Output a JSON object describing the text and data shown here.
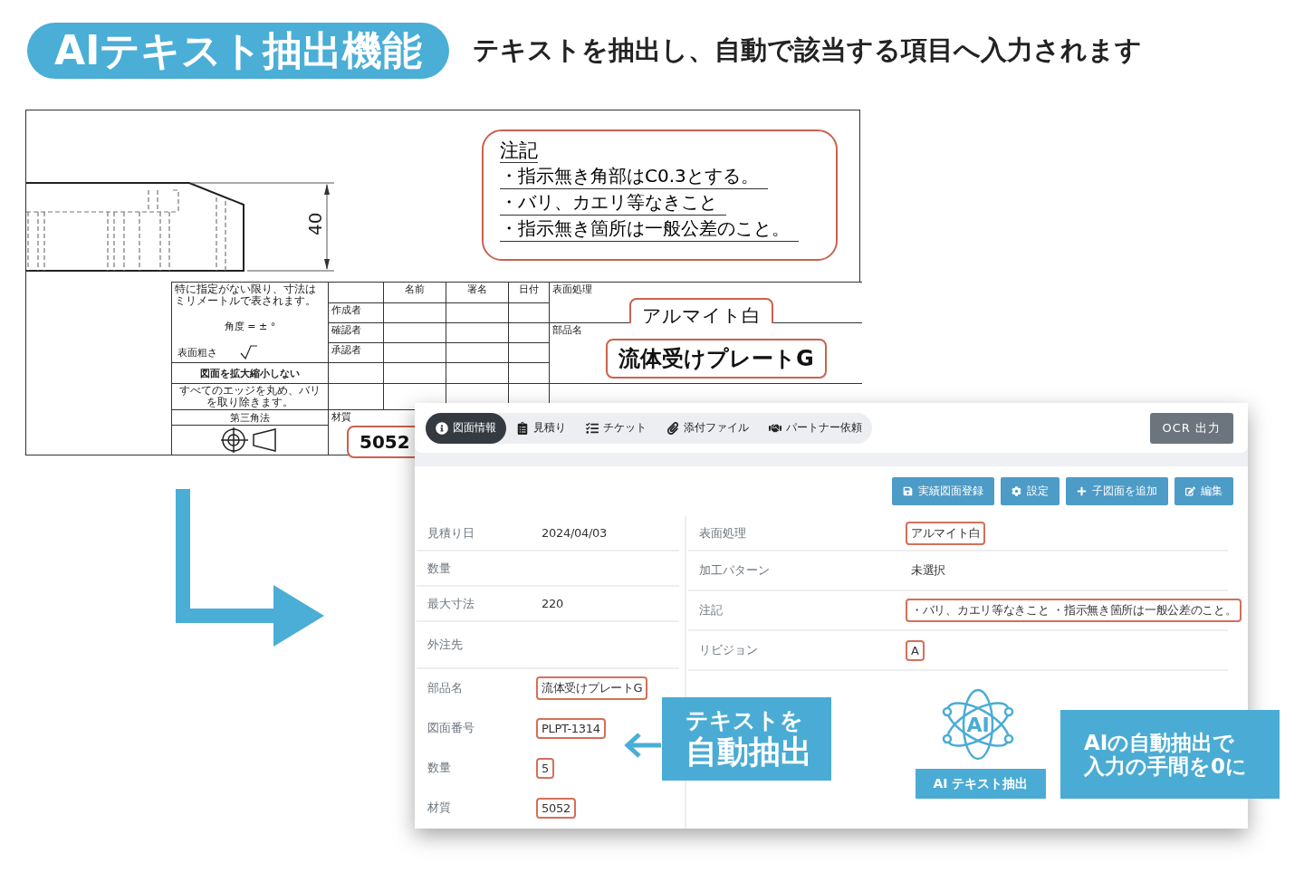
{
  "header": {
    "badge": "AIテキスト抽出機能",
    "subtitle": "テキストを抽出し、自動で該当する項目へ入力されます"
  },
  "drawing": {
    "dimension": "40",
    "notes": {
      "title": "注記",
      "lines": [
        "・指示無き角部はC0.3とする。",
        "・バリ、カエリ等なきこと",
        "・指示無き箇所は一般公差のこと。"
      ]
    },
    "title_block": {
      "general_note": "特に指定がない限り、寸法はミリメートルで表されます。",
      "angle_note": "角度 = ± °",
      "roughness_label": "表面粗さ",
      "scale_note": "図面を拡大縮小しない",
      "edge_note": "すべてのエッジを丸め、バリを取り除きます。",
      "projection": "第三角法",
      "columns": [
        "名前",
        "署名",
        "日付"
      ],
      "roles": [
        "作成者",
        "確認者",
        "承認者"
      ],
      "material_label": "材質",
      "material": "5052",
      "surface_label": "表面処理",
      "surface": "アルマイト白",
      "part_label": "部品名",
      "part_name": "流体受けプレートG"
    }
  },
  "app": {
    "tabs": [
      {
        "label": "図面情報",
        "selected": true
      },
      {
        "label": "見積り",
        "selected": false
      },
      {
        "label": "チケット",
        "selected": false
      },
      {
        "label": "添付ファイル",
        "selected": false
      },
      {
        "label": "パートナー依頼",
        "selected": false
      }
    ],
    "ocr_button": "OCR 出力",
    "actions": [
      "実績図面登録",
      "設定",
      "子図面を追加",
      "編集"
    ],
    "summary_fields": [
      {
        "label": "見積り日",
        "value": "2024/04/03",
        "extracted": false
      },
      {
        "label": "数量"
      },
      {
        "label": "最大寸法",
        "value": "220",
        "extracted": false
      },
      {
        "label": "外注先"
      }
    ],
    "drawing_fields": [
      {
        "label": "部品名",
        "value": "流体受けプレートG",
        "extracted": true
      },
      {
        "label": "図面番号",
        "value": "PLPT-1314",
        "extracted": true
      },
      {
        "label": "数量",
        "value": "5",
        "extracted": true
      },
      {
        "label": "材質",
        "value": "5052",
        "extracted": true
      }
    ],
    "right_fields": [
      {
        "label": "表面処理",
        "value": "アルマイト白",
        "extracted": true
      },
      {
        "label": "加工パターン",
        "value": "未選択",
        "extracted": false
      },
      {
        "label": "注記",
        "value": "・バリ、カエリ等なきこと ・指示無き箇所は一般公差のこと。",
        "extracted": true
      },
      {
        "label": "リビジョン",
        "value": "A",
        "extracted": true
      }
    ]
  },
  "callouts": {
    "extract": [
      "テキストを",
      "自動抽出"
    ],
    "ai_icon": "AI",
    "ai_label": "AI テキスト抽出",
    "zero": [
      "AIの自動抽出で",
      "入力の手間を0に"
    ]
  }
}
